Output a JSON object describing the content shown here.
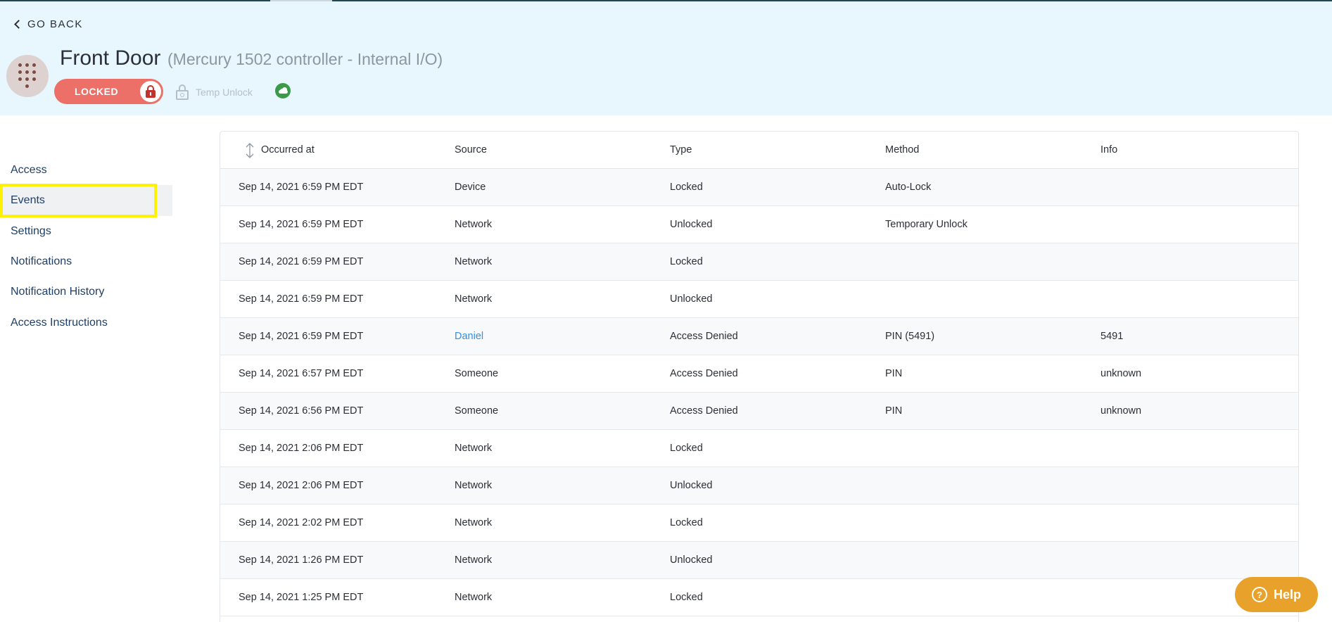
{
  "header": {
    "go_back_label": "GO BACK",
    "title": "Front Door",
    "subtitle": "(Mercury 1502 controller - Internal I/O)",
    "lock_status": "LOCKED",
    "temp_unlock_label": "Temp Unlock",
    "connection_status_icon": "cloud-icon",
    "status_color": "#3a9a48",
    "locked_color": "#ec6f68"
  },
  "sidebar": {
    "items": [
      {
        "label": "Access",
        "active": false
      },
      {
        "label": "Events",
        "active": true
      },
      {
        "label": "Settings",
        "active": false
      },
      {
        "label": "Notifications",
        "active": false
      },
      {
        "label": "Notification History",
        "active": false
      },
      {
        "label": "Access Instructions",
        "active": false
      }
    ]
  },
  "table": {
    "columns": [
      "Occurred at",
      "Source",
      "Type",
      "Method",
      "Info"
    ],
    "rows": [
      {
        "occurred_at": "Sep 14, 2021 6:59 PM EDT",
        "source": "Device",
        "type": "Locked",
        "method": "Auto-Lock",
        "info": ""
      },
      {
        "occurred_at": "Sep 14, 2021 6:59 PM EDT",
        "source": "Network",
        "type": "Unlocked",
        "method": "Temporary Unlock",
        "info": ""
      },
      {
        "occurred_at": "Sep 14, 2021 6:59 PM EDT",
        "source": "Network",
        "type": "Locked",
        "method": "",
        "info": ""
      },
      {
        "occurred_at": "Sep 14, 2021 6:59 PM EDT",
        "source": "Network",
        "type": "Unlocked",
        "method": "",
        "info": ""
      },
      {
        "occurred_at": "Sep 14, 2021 6:59 PM EDT",
        "source": "Daniel",
        "type": "Access Denied",
        "method": "PIN (5491)",
        "info": "5491"
      },
      {
        "occurred_at": "Sep 14, 2021 6:57 PM EDT",
        "source": "Someone",
        "type": "Access Denied",
        "method": "PIN",
        "info": "unknown"
      },
      {
        "occurred_at": "Sep 14, 2021 6:56 PM EDT",
        "source": "Someone",
        "type": "Access Denied",
        "method": "PIN",
        "info": "unknown"
      },
      {
        "occurred_at": "Sep 14, 2021 2:06 PM EDT",
        "source": "Network",
        "type": "Locked",
        "method": "",
        "info": ""
      },
      {
        "occurred_at": "Sep 14, 2021 2:06 PM EDT",
        "source": "Network",
        "type": "Unlocked",
        "method": "",
        "info": ""
      },
      {
        "occurred_at": "Sep 14, 2021 2:02 PM EDT",
        "source": "Network",
        "type": "Locked",
        "method": "",
        "info": ""
      },
      {
        "occurred_at": "Sep 14, 2021 1:26 PM EDT",
        "source": "Network",
        "type": "Unlocked",
        "method": "",
        "info": ""
      },
      {
        "occurred_at": "Sep 14, 2021 1:25 PM EDT",
        "source": "Network",
        "type": "Locked",
        "method": "",
        "info": ""
      }
    ]
  },
  "help": {
    "label": "Help"
  }
}
